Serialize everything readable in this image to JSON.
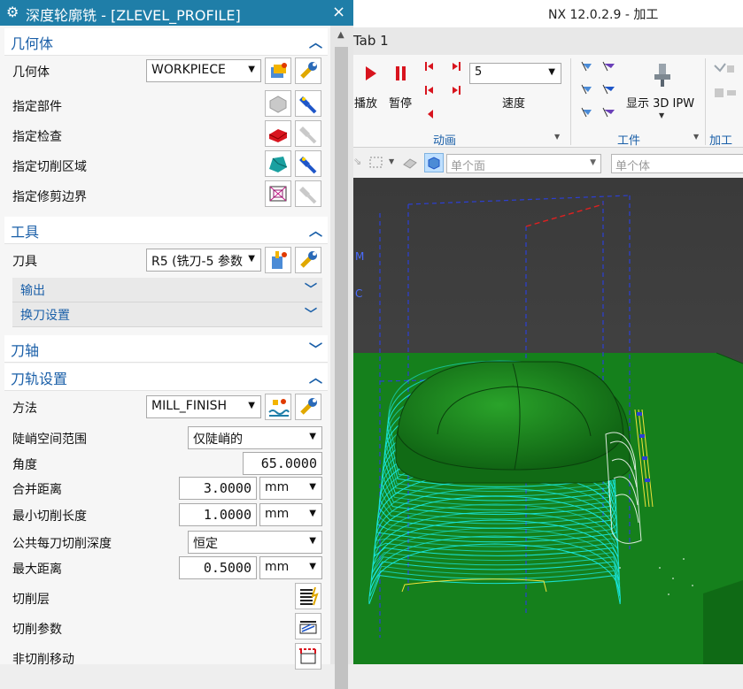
{
  "dialog": {
    "title": "深度轮廓铣 - [ZLEVEL_PROFILE]",
    "close_glyph": "×"
  },
  "sections": {
    "geometry": {
      "title": "几何体",
      "geometry_label": "几何体",
      "geometry_value": "WORKPIECE",
      "specify_part": "指定部件",
      "specify_check": "指定检查",
      "specify_cut_area": "指定切削区域",
      "specify_trim_boundary": "指定修剪边界"
    },
    "tool": {
      "title": "工具",
      "tool_label": "刀具",
      "tool_value": "R5 (铣刀-5 参数",
      "output": "输出",
      "tool_change": "换刀设置"
    },
    "axis": {
      "title": "刀轴"
    },
    "path": {
      "title": "刀轨设置",
      "method_label": "方法",
      "method_value": "MILL_FINISH",
      "steep_label": "陡峭空间范围",
      "steep_value": "仅陡峭的",
      "angle_label": "角度",
      "angle_value": "65.0000",
      "merge_label": "合并距离",
      "merge_value": "3.0000",
      "merge_unit": "mm",
      "min_cut_label": "最小切削长度",
      "min_cut_value": "1.0000",
      "min_cut_unit": "mm",
      "common_depth_label": "公共每刀切削深度",
      "common_depth_value": "恒定",
      "max_dist_label": "最大距离",
      "max_dist_value": "0.5000",
      "max_dist_unit": "mm",
      "cut_levels": "切削层",
      "cut_params": "切削参数",
      "non_cut_moves": "非切削移动"
    }
  },
  "nx": {
    "title": "NX 12.0.2.9 - 加工",
    "tab": "Tab 1",
    "ribbon": {
      "play": "播放",
      "pause": "暂停",
      "speed_value": "5",
      "speed_label": "速度",
      "animation_group": "动画",
      "show_ipw": "显示 3D IPW",
      "workpiece_group": "工件",
      "machining_group": "加工工"
    },
    "filter": {
      "face_filter": "单个面",
      "body_filter": "单个体"
    },
    "viewport": {
      "label_m": "M",
      "label_c": "C"
    }
  },
  "colors": {
    "title_bar": "#1f7ea8",
    "section_text": "#1a5fa8",
    "viewport_bg": "#3b3b3b",
    "model_green": "#14811c",
    "toolpath_cyan": "#19f0f0"
  }
}
